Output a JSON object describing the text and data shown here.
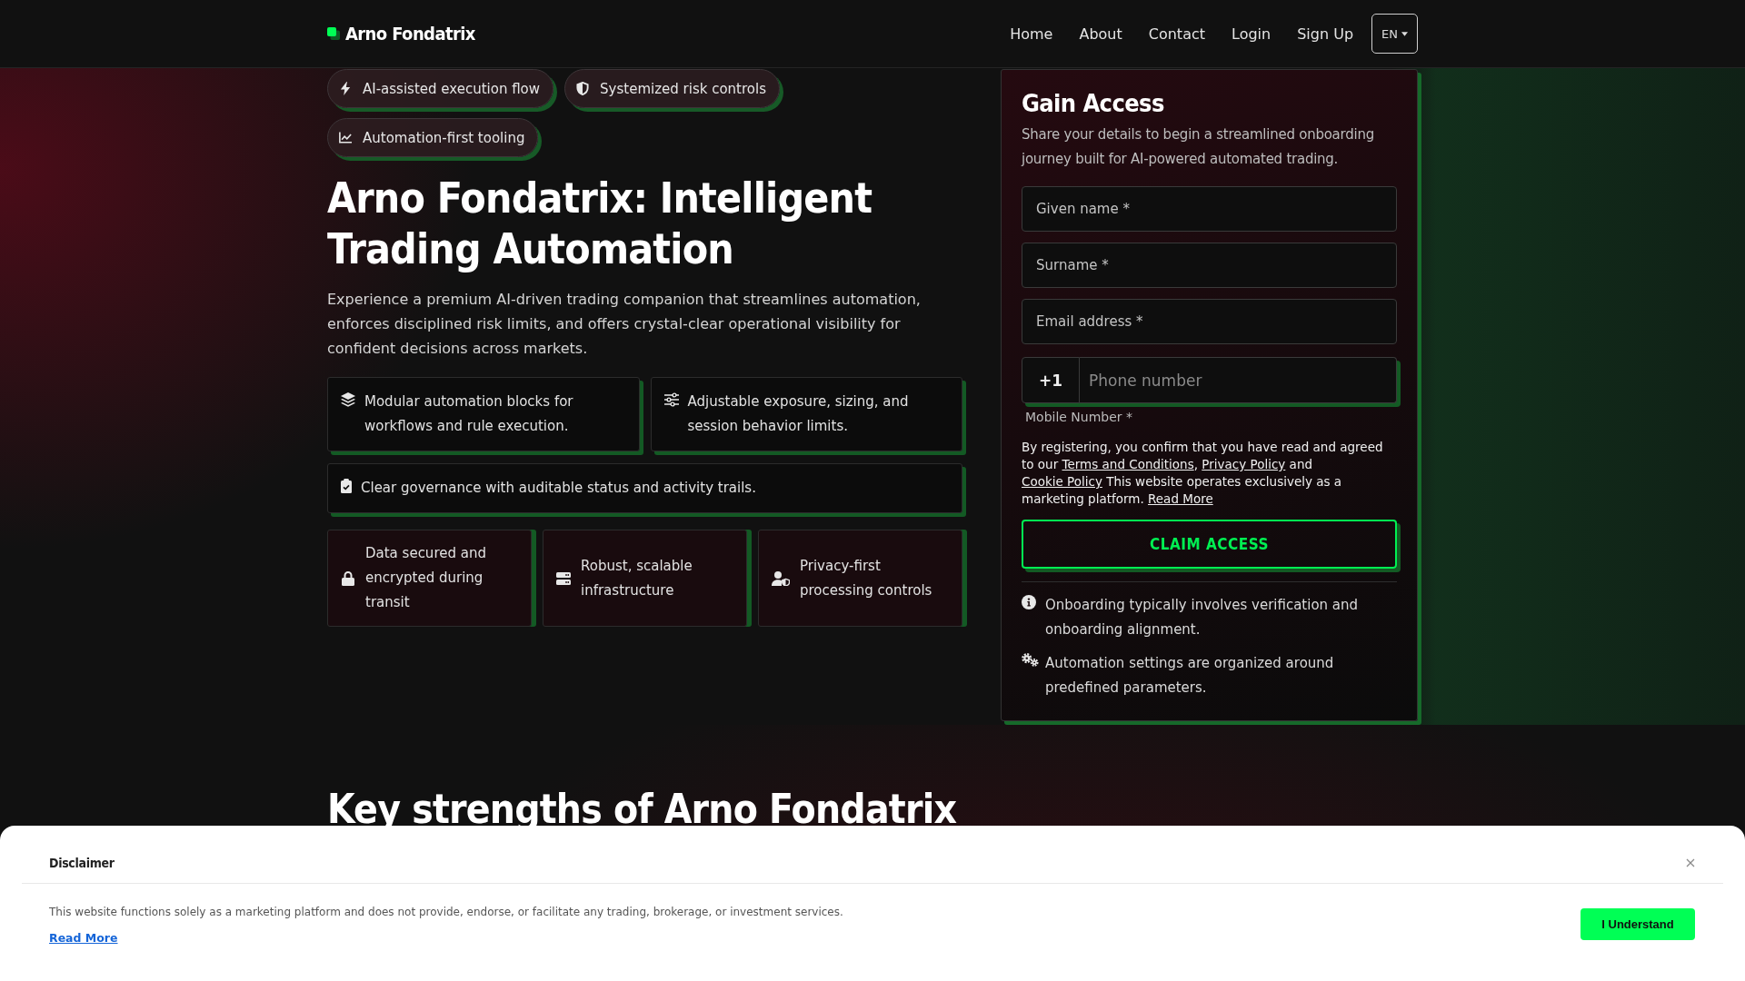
{
  "header": {
    "logo": "Arno Fondatrix",
    "nav": [
      "Home",
      "About",
      "Contact",
      "Login",
      "Sign Up"
    ],
    "language": "EN"
  },
  "hero": {
    "tags": [
      "AI-assisted execution flow",
      "Systemized risk controls",
      "Automation-first tooling"
    ],
    "title": "Arno Fondatrix: Intelligent Trading Automation",
    "intro": "Experience a premium AI-driven trading companion that streamlines automation, enforces disciplined risk limits, and offers crystal-clear operational visibility for confident decisions across markets.",
    "features": [
      "Modular automation blocks for workflows and rule execution.",
      "Adjustable exposure, sizing, and session behavior limits.",
      "Clear governance with auditable status and activity trails."
    ],
    "assurances": [
      "Data secured and encrypted during transit",
      "Robust, scalable infrastructure",
      "Privacy-first processing controls"
    ]
  },
  "signup": {
    "title": "Gain Access",
    "subtitle": "Share your details to begin a streamlined onboarding journey built for AI-powered automated trading.",
    "fields": [
      {
        "placeholder": "Given name *"
      },
      {
        "placeholder": "Surname *"
      },
      {
        "placeholder": "Email address *"
      }
    ],
    "phone": {
      "prefix": "+1",
      "placeholder": "Phone number",
      "label": "Mobile Number *"
    },
    "consent": [
      {
        "kind": "text",
        "text": "By registering, you confirm that you have read and agreed to our "
      },
      {
        "kind": "link",
        "text": "Terms and Conditions"
      },
      {
        "kind": "text",
        "text": ", "
      },
      {
        "kind": "link",
        "text": "Privacy Policy"
      },
      {
        "kind": "text",
        "text": " and "
      },
      {
        "kind": "link",
        "text": "Cookie Policy"
      },
      {
        "kind": "text",
        "text": " This website operates exclusively as a marketing platform. "
      },
      {
        "kind": "link",
        "text": "Read More"
      }
    ],
    "button": "CLAIM ACCESS",
    "notes": [
      "Onboarding typically involves verification and onboarding alignment.",
      "Automation settings are organized around predefined parameters."
    ]
  },
  "strengths": {
    "title": "Key strengths of Arno Fondatrix"
  },
  "disclaimer": {
    "title": "Disclaimer",
    "text": "This website functions solely as a marketing platform and does not provide, endorse, or facilitate any trading, brokerage, or investment services.",
    "link": "Read More",
    "button": "I Understand"
  }
}
